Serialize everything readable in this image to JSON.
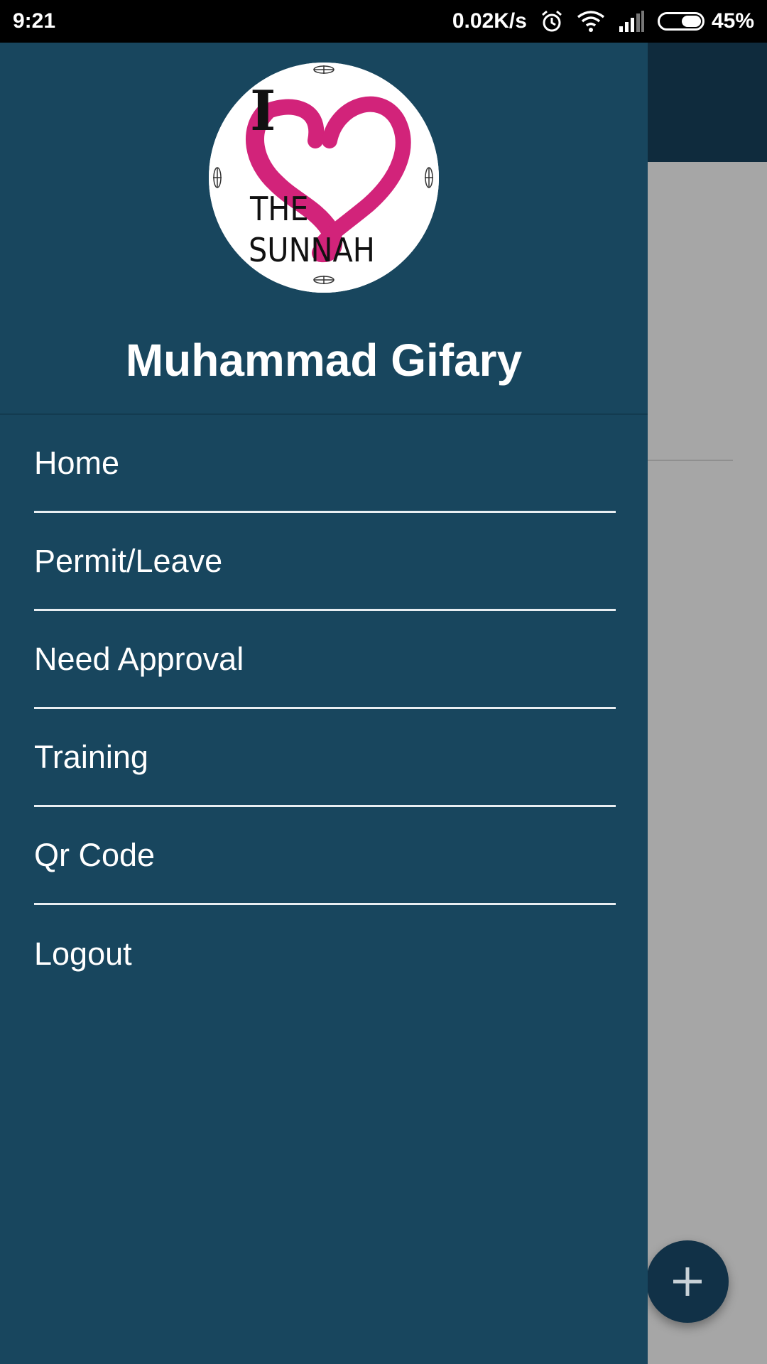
{
  "status_bar": {
    "time": "9:21",
    "network_speed": "0.02K/s",
    "icons": [
      "alarm-icon",
      "wifi-icon",
      "signal-icon",
      "battery-icon"
    ],
    "battery_level": 0.45,
    "battery_percent": "45%"
  },
  "drawer": {
    "avatar_logo_text": "I THE SUNNAH",
    "user_name": "Muhammad Gifary",
    "menu_items": [
      {
        "label": "Home"
      },
      {
        "label": "Permit/Leave"
      },
      {
        "label": "Need Approval"
      },
      {
        "label": "Training"
      },
      {
        "label": "Qr Code"
      },
      {
        "label": "Logout"
      }
    ]
  },
  "fab": {
    "icon": "plus-icon"
  },
  "colors": {
    "drawer_bg": "#18465e",
    "toolbar_bg": "#0f2b3d",
    "scrim_bg": "#a6a6a6",
    "fab_bg": "#113147",
    "logo_pink": "#d2237a"
  }
}
